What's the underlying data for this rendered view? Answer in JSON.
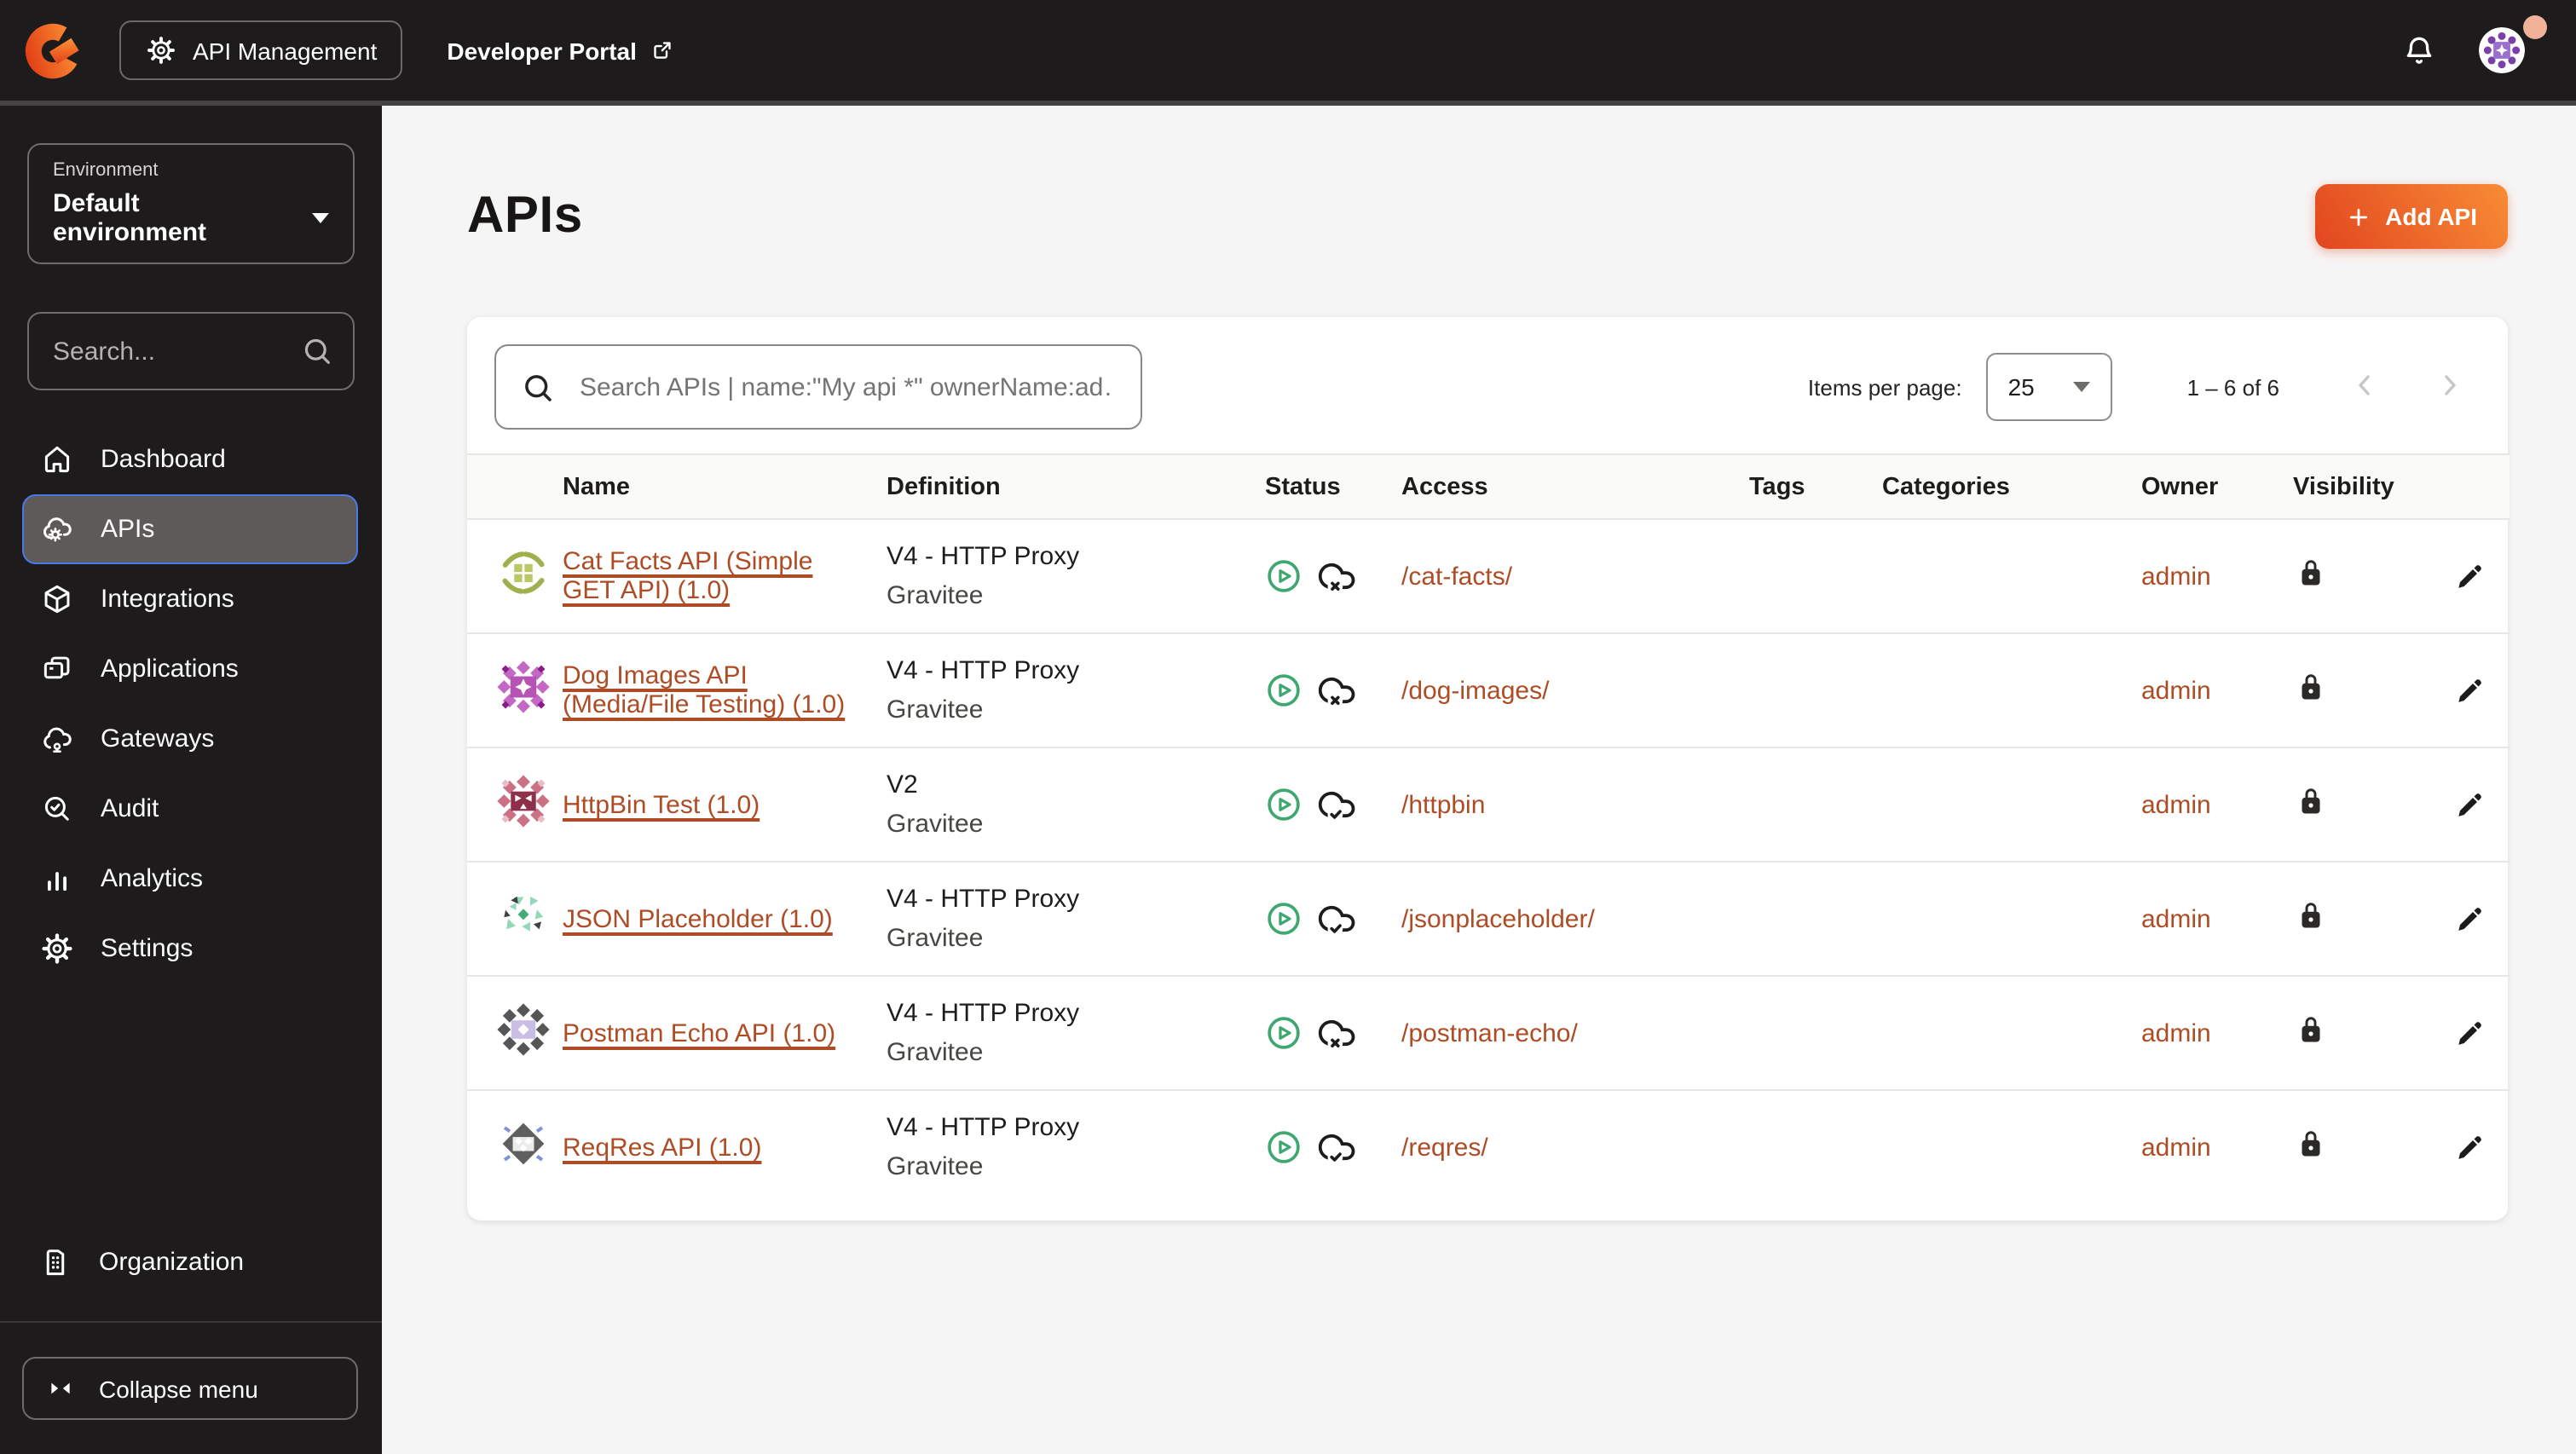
{
  "topbar": {
    "product_label": "API Management",
    "portal_link_label": "Developer Portal"
  },
  "sidebar": {
    "environment_label": "Environment",
    "environment_value": "Default environment",
    "search_placeholder": "Search...",
    "items": [
      {
        "label": "Dashboard"
      },
      {
        "label": "APIs"
      },
      {
        "label": "Integrations"
      },
      {
        "label": "Applications"
      },
      {
        "label": "Gateways"
      },
      {
        "label": "Audit"
      },
      {
        "label": "Analytics"
      },
      {
        "label": "Settings"
      }
    ],
    "organization_label": "Organization",
    "collapse_label": "Collapse menu"
  },
  "main": {
    "title": "APIs",
    "add_api_label": "Add API",
    "toolbar": {
      "search_placeholder": "Search APIs | name:\"My api *\" ownerName:ad…",
      "items_per_page_label": "Items per page:",
      "items_per_page_value": "25",
      "range_label": "1 – 6 of 6"
    },
    "table": {
      "columns": [
        "Name",
        "Definition",
        "Status",
        "Access",
        "Tags",
        "Categories",
        "Owner",
        "Visibility"
      ],
      "rows": [
        {
          "name": "Cat Facts API (Simple GET API) (1.0)",
          "definition": "V4 - HTTP Proxy",
          "provider": "Gravitee",
          "access": "/cat-facts/",
          "owner": "admin",
          "status_started": true,
          "published_on_portal": false,
          "visibility": "private",
          "avatar": {
            "variant": "arc-squares",
            "primary": "#9fb14c",
            "secondary": "#bcc765",
            "accent": "#76892f"
          }
        },
        {
          "name": "Dog Images API (Media/File Testing) (1.0)",
          "definition": "V4 - HTTP Proxy",
          "provider": "Gravitee",
          "access": "/dog-images/",
          "owner": "admin",
          "status_started": true,
          "published_on_portal": false,
          "visibility": "private",
          "avatar": {
            "variant": "diamond-star",
            "primary": "#c369c3",
            "secondary": "#b654b6",
            "accent": "#8a1c8a"
          }
        },
        {
          "name": "HttpBin Test (1.0)",
          "definition": "V2",
          "provider": "Gravitee",
          "access": "/httpbin",
          "owner": "admin",
          "status_started": true,
          "published_on_portal": true,
          "visibility": "private",
          "avatar": {
            "variant": "diamond-tris",
            "primary": "#cb7186",
            "secondary": "#8e3049",
            "accent": "#e9bcc7"
          }
        },
        {
          "name": "JSON Placeholder (1.0)",
          "definition": "V4 - HTTP Proxy",
          "provider": "Gravitee",
          "access": "/jsonplaceholder/",
          "owner": "admin",
          "status_started": true,
          "published_on_portal": true,
          "visibility": "private",
          "avatar": {
            "variant": "scatter-tris",
            "primary": "#93d9b9",
            "secondary": "#44ab78",
            "accent": "#3f4040"
          }
        },
        {
          "name": "Postman Echo API (1.0)",
          "definition": "V4 - HTTP Proxy",
          "provider": "Gravitee",
          "access": "/postman-echo/",
          "owner": "admin",
          "status_started": true,
          "published_on_portal": false,
          "visibility": "private",
          "avatar": {
            "variant": "diamond-lav",
            "primary": "#565656",
            "secondary": "#c9bfe6",
            "accent": "#4a4a4a"
          }
        },
        {
          "name": "ReqRes API (1.0)",
          "definition": "V4 - HTTP Proxy",
          "provider": "Gravitee",
          "access": "/reqres/",
          "owner": "admin",
          "status_started": true,
          "published_on_portal": true,
          "visibility": "private",
          "avatar": {
            "variant": "big-diamond",
            "primary": "#5f5f5f",
            "secondary": "#ececec",
            "accent": "#7d92d8"
          }
        }
      ]
    }
  },
  "colors": {
    "accent_link": "#ad4c25",
    "status_green": "#3fa871",
    "selected_border": "#4a79e8",
    "topbar_bg": "#1d1b1c",
    "main_bg": "#f6f5f5",
    "button_gradient_start": "#e2461f",
    "button_gradient_end": "#f88c35",
    "presence_badge": "#f2b29a"
  }
}
